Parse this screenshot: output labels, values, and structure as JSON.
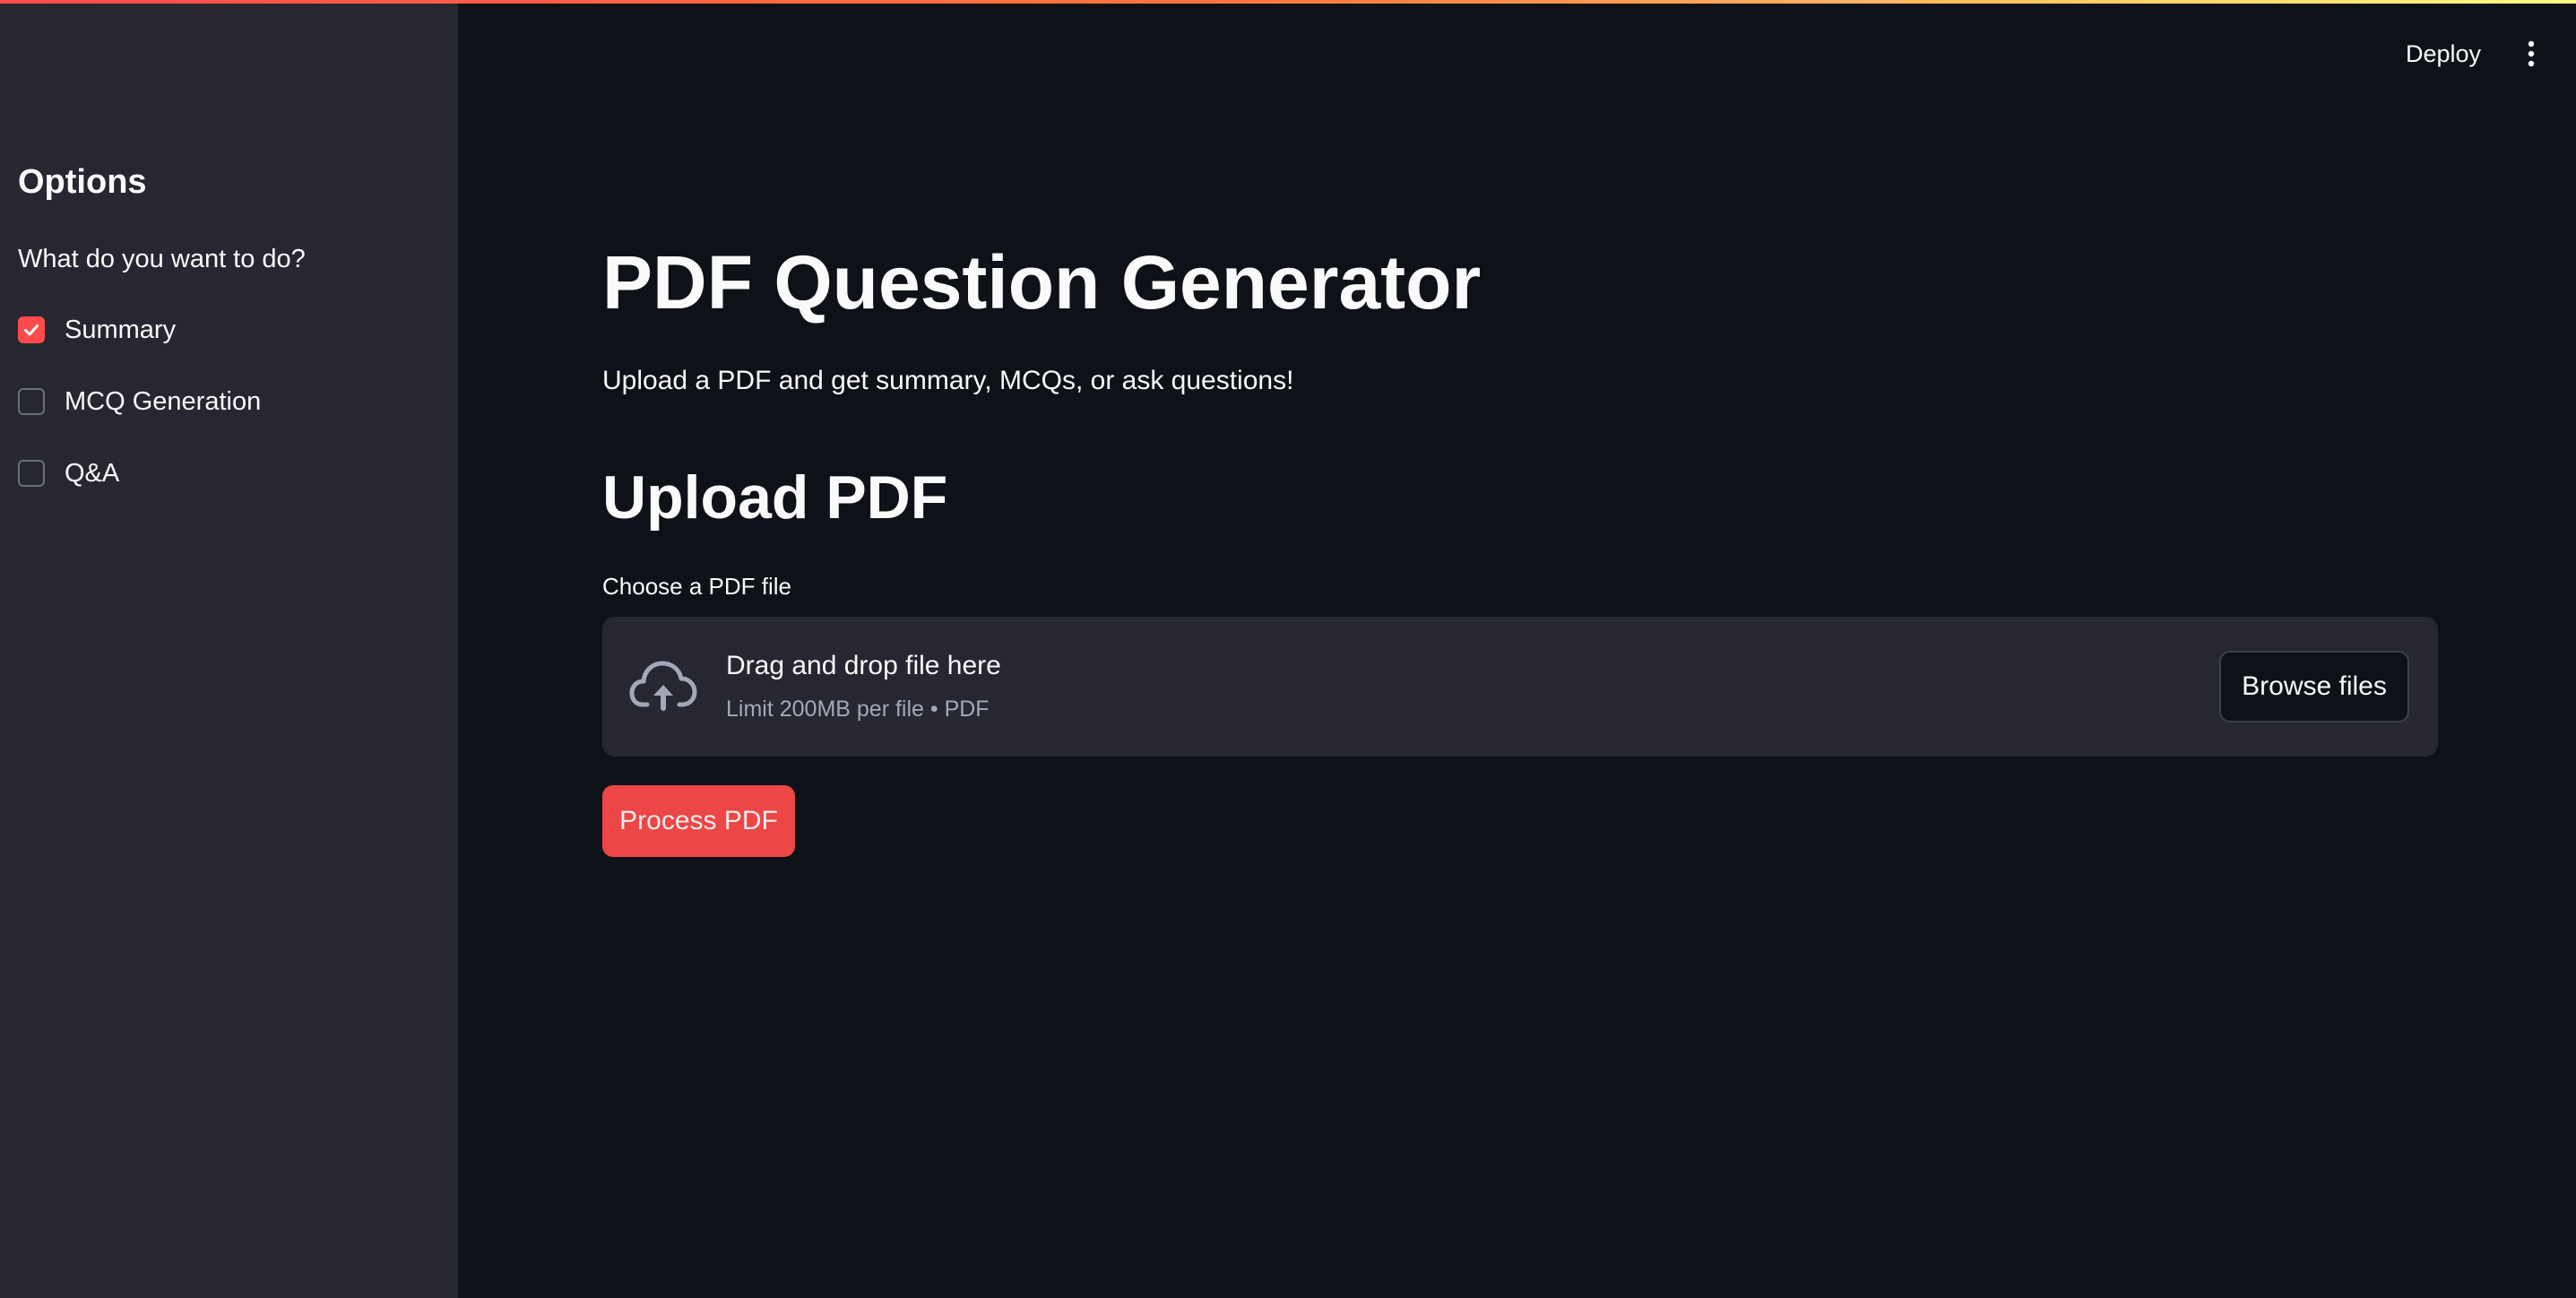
{
  "header": {
    "deploy_label": "Deploy",
    "menu_icon": "kebab-vertical-icon"
  },
  "sidebar": {
    "title": "Options",
    "question": "What do you want to do?",
    "options": [
      {
        "label": "Summary",
        "checked": true
      },
      {
        "label": "MCQ Generation",
        "checked": false
      },
      {
        "label": "Q&A",
        "checked": false
      }
    ]
  },
  "main": {
    "title": "PDF Question Generator",
    "subtitle": "Upload a PDF and get summary, MCQs, or ask questions!",
    "section_title": "Upload PDF",
    "uploader": {
      "label": "Choose a PDF file",
      "drop_text": "Drag and drop file here",
      "limit_text": "Limit 200MB per file • PDF",
      "browse_label": "Browse files",
      "icon": "cloud-upload-icon"
    },
    "process_label": "Process PDF"
  },
  "colors": {
    "accent": "#ff4b4b",
    "background": "#0e1117",
    "sidebar_background": "#262730",
    "secondary_text": "#a3a8b8"
  }
}
